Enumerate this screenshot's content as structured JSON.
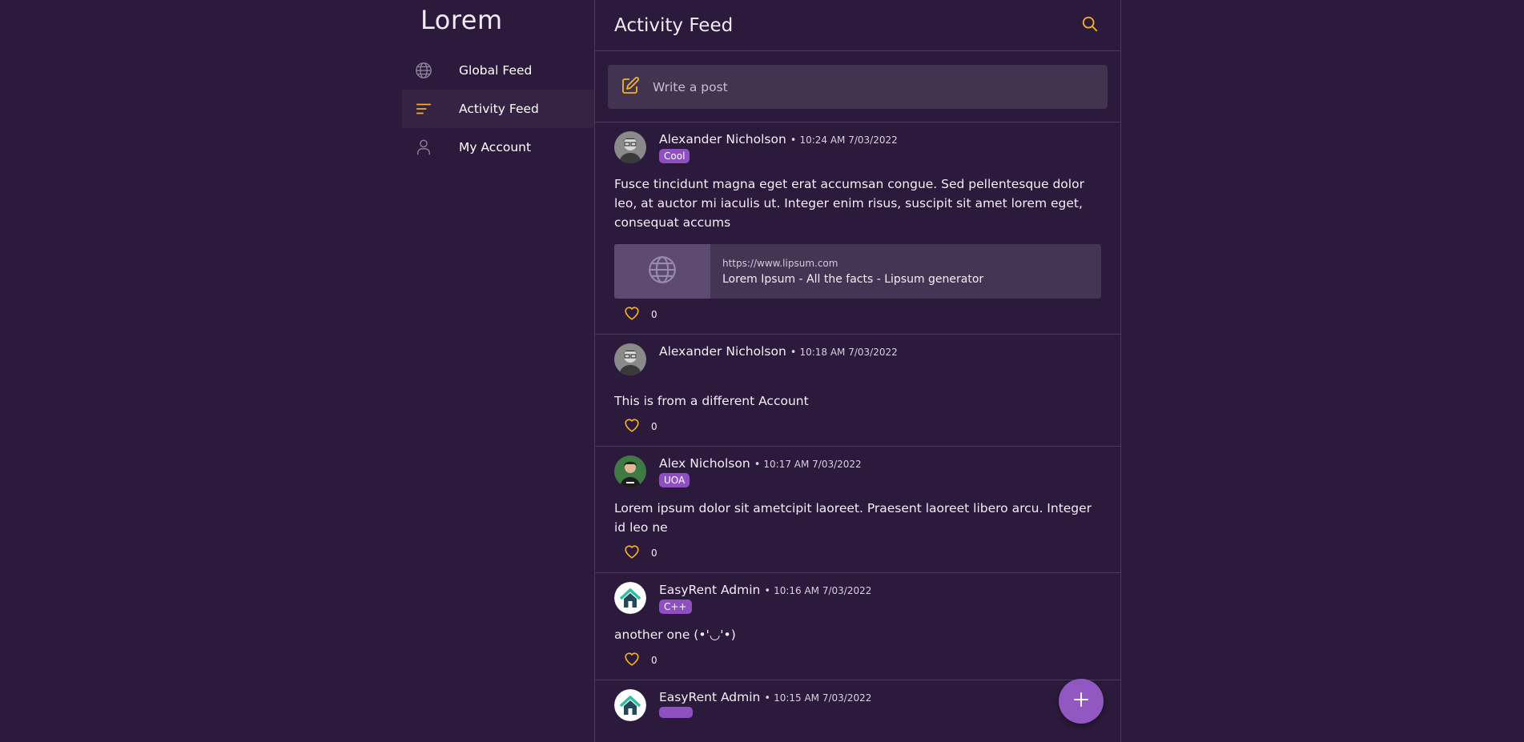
{
  "brand": "Lorem",
  "nav": [
    {
      "label": "Global Feed",
      "icon": "globe-icon"
    },
    {
      "label": "Activity Feed",
      "icon": "activity-lines-icon",
      "active": true
    },
    {
      "label": "My Account",
      "icon": "person-icon"
    }
  ],
  "header": {
    "title": "Activity Feed"
  },
  "composer": {
    "placeholder": "Write a post"
  },
  "colors": {
    "accent": "#f5b323",
    "tag": "#8e4fc0",
    "fab": "#9158c2",
    "background": "#2b1a3b"
  },
  "posts": [
    {
      "author": "Alexander Nicholson",
      "time": "10:24 AM 7/03/2022",
      "tag": "Cool",
      "body": "Fusce tincidunt magna eget erat accumsan congue. Sed pellentesque dolor leo, at auctor mi iaculis ut. Integer enim risus, suscipit sit amet lorem eget, consequat accums",
      "link": {
        "url": "https://www.lipsum.com",
        "title": "Lorem Ipsum - All the facts - Lipsum generator"
      },
      "likes": "0"
    },
    {
      "author": "Alexander Nicholson",
      "time": "10:18 AM 7/03/2022",
      "body": "This is from a different Account",
      "likes": "0"
    },
    {
      "author": "Alex Nicholson",
      "time": "10:17 AM 7/03/2022",
      "tag": "UOA",
      "body": "Lorem ipsum dolor sit ametcipit laoreet. Praesent laoreet libero arcu. Integer id leo ne",
      "likes": "0"
    },
    {
      "author": "EasyRent Admin",
      "time": "10:16 AM 7/03/2022",
      "tag": "C++",
      "body": "another one (•'◡'•)",
      "likes": "0"
    },
    {
      "author": "EasyRent Admin",
      "time": "10:15 AM 7/03/2022"
    }
  ],
  "separator": "•"
}
